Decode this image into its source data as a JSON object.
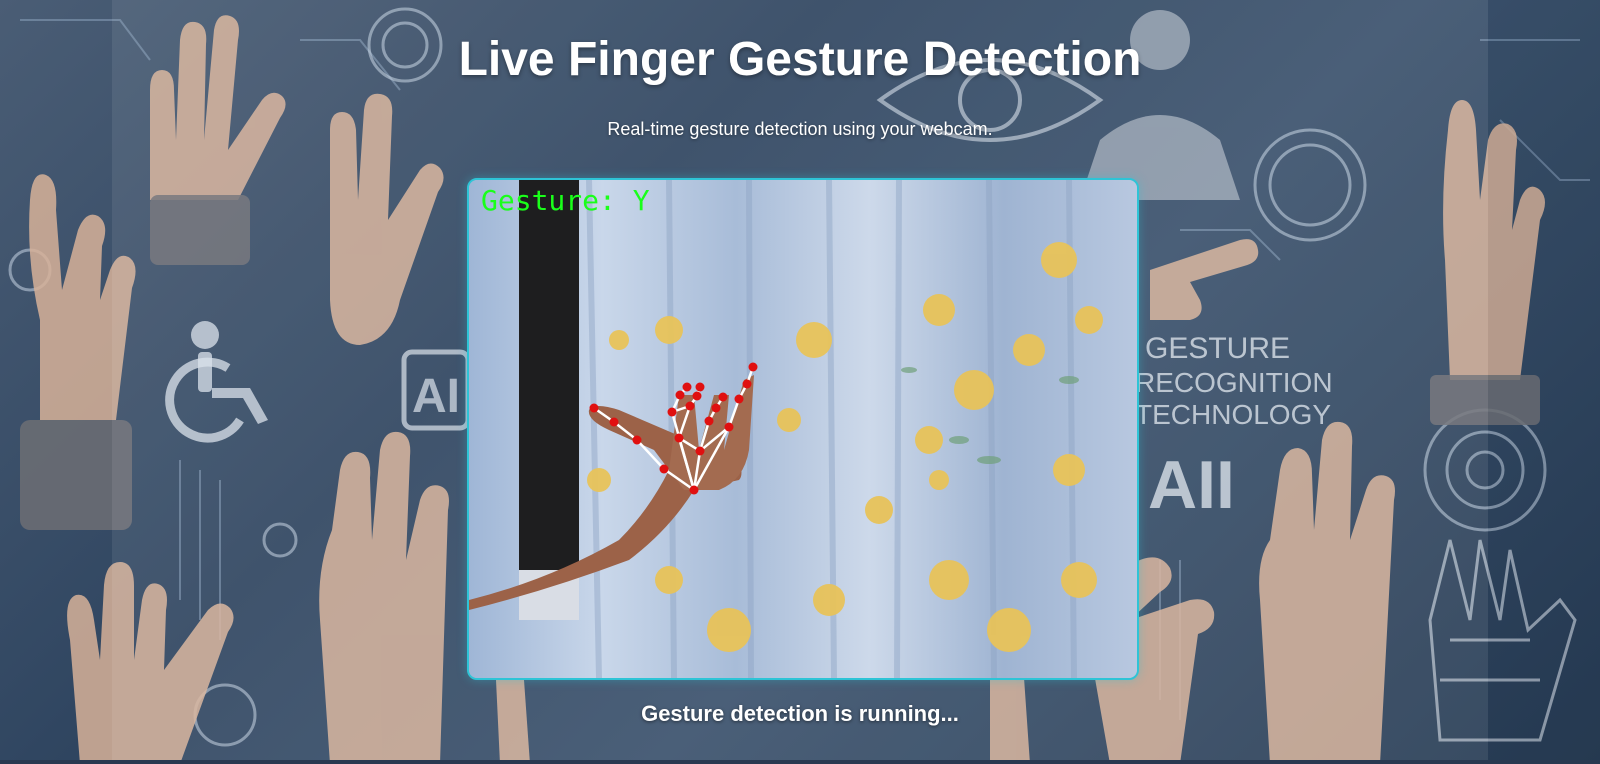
{
  "header": {
    "title": "Live Finger Gesture Detection",
    "subtitle": "Real-time gesture detection using your webcam."
  },
  "video": {
    "gesture_label": "Gesture: Y"
  },
  "background_text": {
    "line1": "GESTURE",
    "line2": "RECOGNITION",
    "line3": "TECHNOLOGY",
    "ai_right": "AII",
    "ai_left": "AI"
  },
  "status": {
    "text": "Gesture detection is running..."
  },
  "colors": {
    "accent_border": "#2ec4d6",
    "gesture_text": "#1aff1a",
    "landmark": "#e01010",
    "connection": "#ffffff"
  }
}
